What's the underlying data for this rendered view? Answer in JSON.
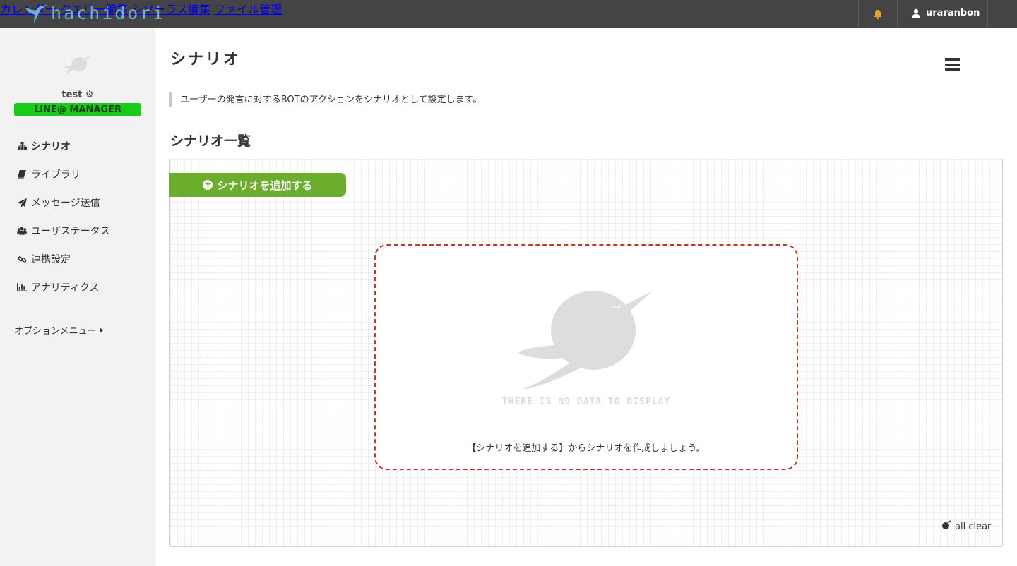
{
  "brand": {
    "name": "hachidori"
  },
  "topnav": {
    "items": [
      "カレンダー",
      "クエリー編集",
      "シソーラス編集",
      "ファイル管理"
    ],
    "username": "uraranbon"
  },
  "sidebar": {
    "account": "test",
    "badge": "LINE@ MANAGER",
    "items": [
      {
        "label": "シナリオ",
        "icon": "sitemap-icon"
      },
      {
        "label": "ライブラリ",
        "icon": "book-icon"
      },
      {
        "label": "メッセージ送信",
        "icon": "paper-plane-icon"
      },
      {
        "label": "ユーザステータス",
        "icon": "users-icon"
      },
      {
        "label": "連携設定",
        "icon": "link-icon"
      },
      {
        "label": "アナリティクス",
        "icon": "bar-chart-icon"
      }
    ],
    "option_menu": "オプションメニュー"
  },
  "main": {
    "title": "シナリオ",
    "description": "ユーザーの発言に対するBOTのアクションをシナリオとして設定します。",
    "section_title": "シナリオ一覧",
    "add_button": "シナリオを追加する",
    "empty_caption": "THERE IS NO DATA TO DISPLAY",
    "empty_message": "【シナリオを追加する】からシナリオを作成しましょう。",
    "all_clear": "all clear"
  },
  "colors": {
    "topbar": "#444444",
    "brand": "#6fb0c8",
    "badge": "#19cc19",
    "add_button": "#6aae2c",
    "empty_border": "#c0392b",
    "bell": "#f0a020"
  }
}
